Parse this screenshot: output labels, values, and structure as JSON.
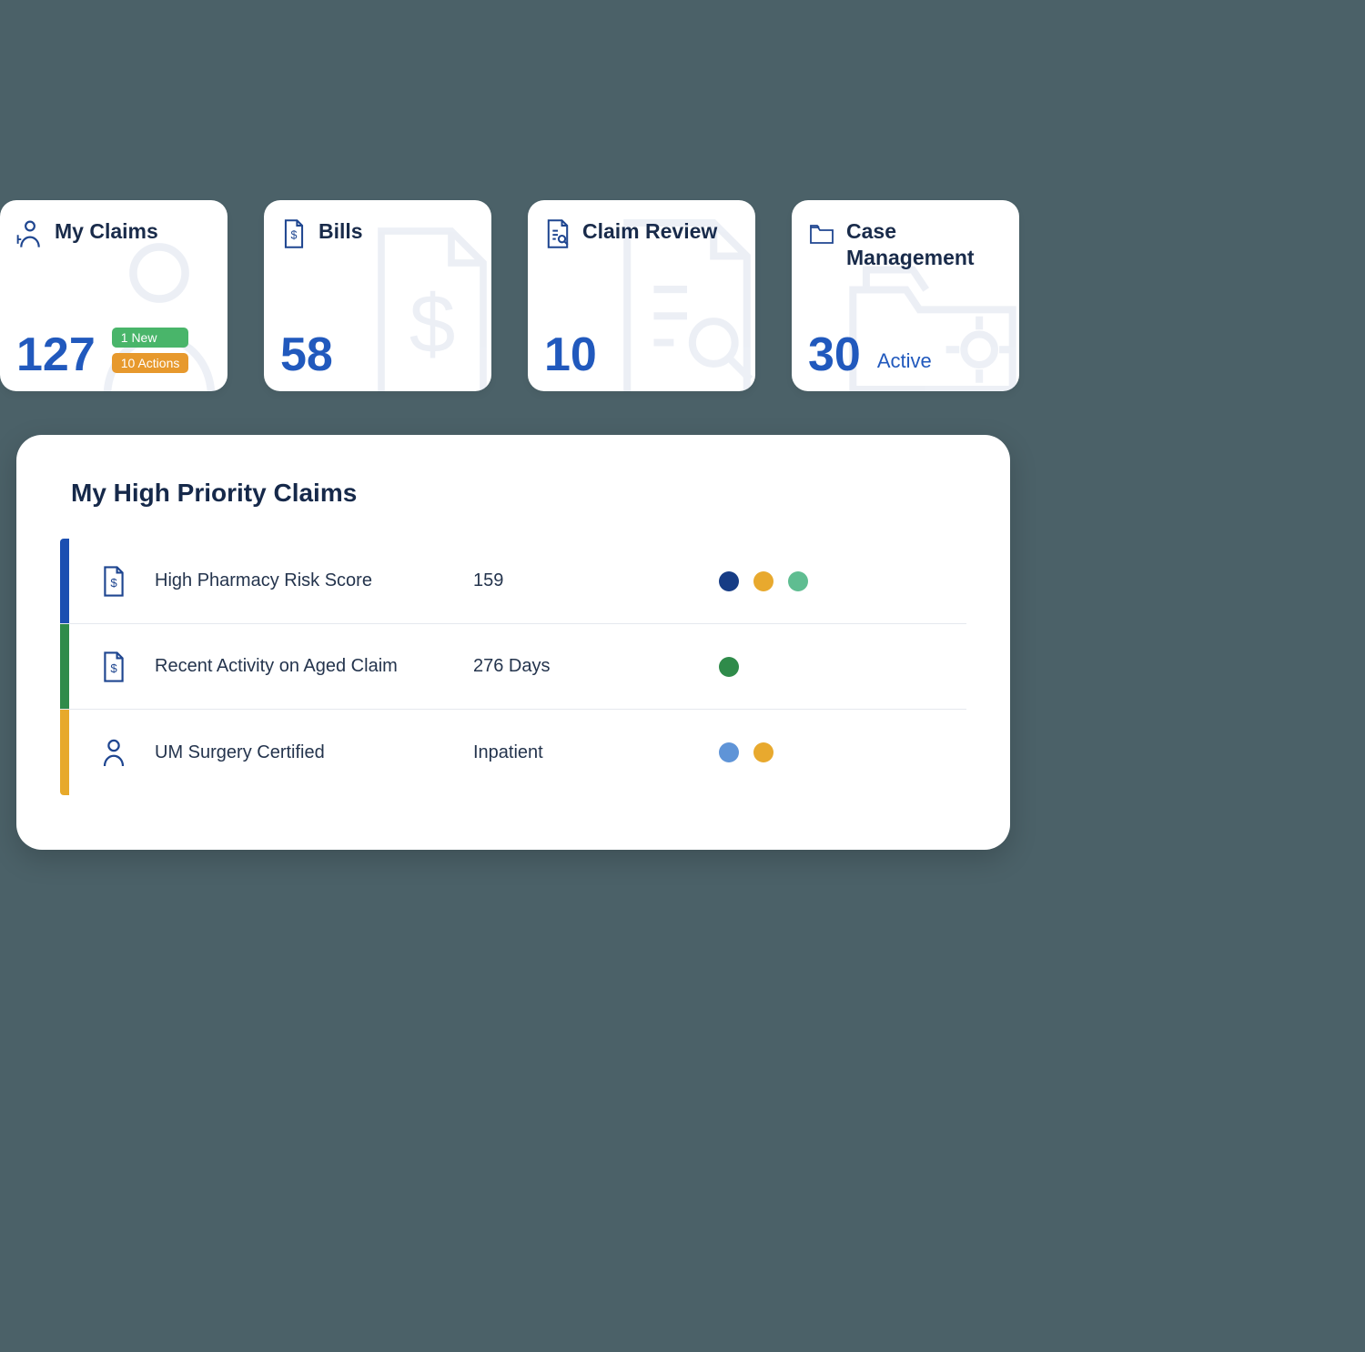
{
  "cards": {
    "my_claims": {
      "title": "My Claims",
      "value": "127",
      "badge_new": "1 New",
      "badge_actions": "10 Actions"
    },
    "bills": {
      "title": "Bills",
      "value": "58"
    },
    "claim_review": {
      "title": "Claim Review",
      "value": "10"
    },
    "case_management": {
      "title": "Case Management",
      "value": "30",
      "suffix": "Active"
    }
  },
  "panel": {
    "title": "My High Priority Claims",
    "rows": [
      {
        "title": "High Pharmacy Risk Score",
        "value": "159"
      },
      {
        "title": "Recent Activity on Aged Claim",
        "value": "276 Days"
      },
      {
        "title": "UM Surgery Certified",
        "value": "Inpatient"
      }
    ]
  }
}
